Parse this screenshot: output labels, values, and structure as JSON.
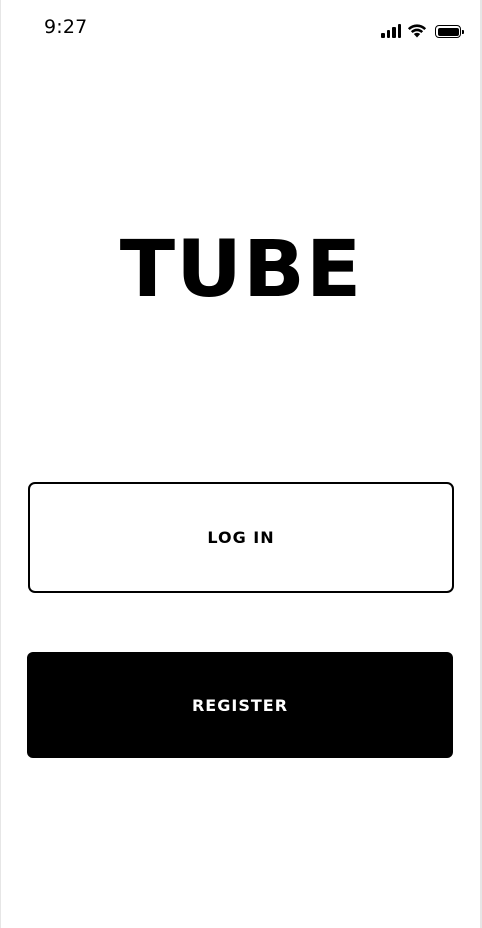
{
  "status_bar": {
    "time": "9:27",
    "icons": [
      "cellular-signal-icon",
      "wifi-icon",
      "battery-icon"
    ]
  },
  "app": {
    "logo_text": "TUBE"
  },
  "actions": {
    "login_label": "LOG IN",
    "register_label": "REGISTER"
  },
  "colors": {
    "background": "#ffffff",
    "primary": "#000000",
    "on_primary": "#ffffff"
  }
}
